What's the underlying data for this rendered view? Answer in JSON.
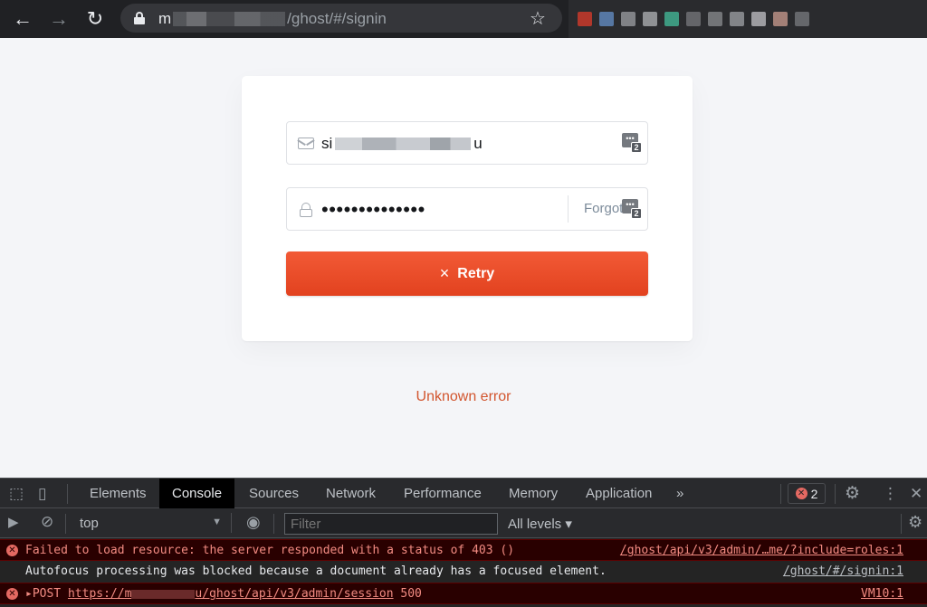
{
  "browser": {
    "url_prefix": "m",
    "url_path": "/ghost/#/signin"
  },
  "signin": {
    "email_prefix": "si",
    "email_suffix": "u",
    "password_mask": "••••••••••••••",
    "password_manager_count": "2",
    "forgot_label": "Forgot",
    "retry_icon": "×",
    "retry_label": "Retry",
    "error_message": "Unknown error"
  },
  "devtools": {
    "tabs": [
      "Elements",
      "Console",
      "Sources",
      "Network",
      "Performance",
      "Memory",
      "Application"
    ],
    "active_tab": "Console",
    "more_tabs": "»",
    "error_count": "2",
    "context": "top",
    "filter_placeholder": "Filter",
    "levels_label": "All levels ▾",
    "logs": [
      {
        "level": "error",
        "message": "Failed to load resource: the server responded with a status of 403 ()",
        "source": "/ghost/api/v3/admin/…me/?include=roles:1"
      },
      {
        "level": "info",
        "message": "Autofocus processing was blocked because a document already has a focused element.",
        "source": "/ghost/#/signin:1"
      },
      {
        "level": "error",
        "message_prefix": "▸POST ",
        "url_start": "https://m",
        "url_end": "u/ghost/api/v3/admin/session",
        "status": " 500",
        "source": "VM10:1"
      }
    ]
  },
  "colors": {
    "accent": "#e2421f",
    "error_text": "#d2552e",
    "page_bg": "#f4f5f8"
  }
}
